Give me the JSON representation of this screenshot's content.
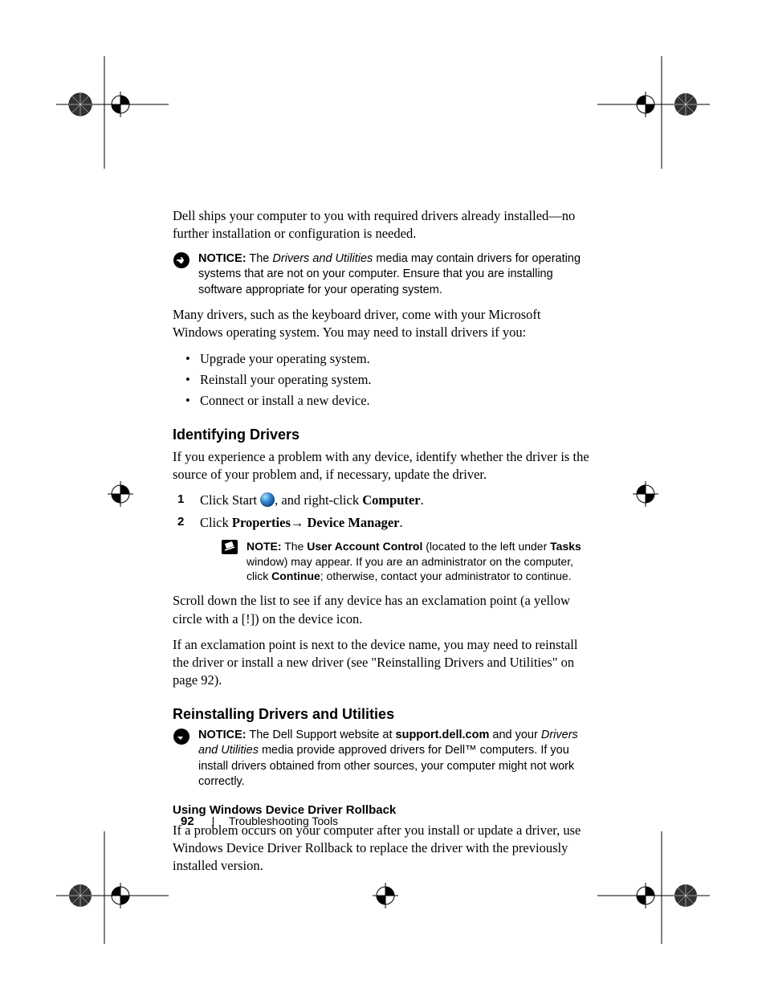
{
  "intro": "Dell ships your computer to you with required drivers already installed—no further installation or configuration is needed.",
  "notice1": {
    "label": "NOTICE:",
    "before": " The ",
    "em": "Drivers and Utilities",
    "after": " media may contain drivers for operating systems that are not on your computer. Ensure that you are installing software appropriate for your operating system."
  },
  "drivers_intro": "Many drivers, such as the keyboard driver, come with your Microsoft Windows operating system. You may need to install drivers if you:",
  "bullets": [
    "Upgrade your operating system.",
    "Reinstall your operating system.",
    "Connect or install a new device."
  ],
  "identifying": {
    "heading": "Identifying Drivers",
    "p1": "If you experience a problem with any device, identify whether the driver is the source of your problem and, if necessary, update the driver.",
    "step1_a": "Click Start ",
    "step1_b": ", and right-click ",
    "step1_bold": "Computer",
    "step1_c": ".",
    "step2_a": "Click ",
    "step2_bold1": "Properties",
    "step2_arrow": "→ ",
    "step2_bold2": "Device Manager",
    "step2_c": "."
  },
  "note2": {
    "label": "NOTE:",
    "a": " The ",
    "b1": "User Account Control",
    "c": " (located to the left under ",
    "b2": "Tasks",
    "d": " window) may appear. If you are an administrator on the computer, click ",
    "b3": "Continue",
    "e": "; otherwise, contact your administrator to continue."
  },
  "scroll_p": "Scroll down the list to see if any device has an exclamation point (a yellow circle with a [!]) on the device icon.",
  "excl_p": "If an exclamation point is next to the device name, you may need to reinstall the driver or install a new driver (see \"Reinstalling Drivers and Utilities\" on page 92).",
  "reinstall": {
    "heading": "Reinstalling Drivers and Utilities"
  },
  "notice3": {
    "label": "NOTICE:",
    "a": " The Dell Support website at ",
    "b1": "support.dell.com",
    "b": " and your ",
    "em": "Drivers and Utilities",
    "c": " media provide approved drivers for Dell™ computers. If you install drivers obtained from other sources, your computer might not work correctly."
  },
  "rollback": {
    "heading": "Using Windows Device Driver Rollback",
    "p": "If a problem occurs on your computer after you install or update a driver, use Windows Device Driver Rollback to replace the driver with the previously installed version."
  },
  "footer": {
    "page": "92",
    "section": "Troubleshooting Tools"
  }
}
